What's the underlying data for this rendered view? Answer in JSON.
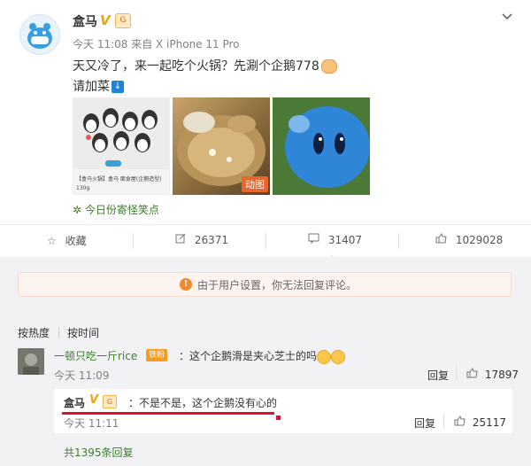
{
  "post": {
    "author": "盒马",
    "verified_mark": "V",
    "level_badge": "G",
    "meta": "今天 11:08 来自 X iPhone 11 Pro",
    "text_line1": "天又冷了，来一起吃个火锅？先涮个企鹅778",
    "text_line2": "请加菜",
    "download_icon": "↓",
    "images": [
      {
        "kind": "product-card",
        "caption": "【盒马火锅】盒马 面食屋(企鹅造型)",
        "weight": "130g"
      },
      {
        "kind": "hotpot",
        "badge": "动图"
      },
      {
        "kind": "blue-plush"
      }
    ],
    "topic": "今日份寄怪笑点",
    "menu_icon": "chevron-down-icon"
  },
  "actions": {
    "favorite_label": "收藏",
    "repost_count": "26371",
    "comment_count": "31407",
    "like_count": "1029028"
  },
  "notice": {
    "icon": "!",
    "text": "由于用户设置，你无法回复评论。"
  },
  "sort": {
    "hot": "按热度",
    "time": "按时间"
  },
  "comment": {
    "username": "一顿只吃一斤rice",
    "fan_badge": "铁粉",
    "text": "：这个企鹅滑是夹心芝士的吗",
    "time": "今天 11:09",
    "reply_label": "回复",
    "like_count": "17897",
    "subreply": {
      "username": "盒马",
      "verified_mark": "V",
      "level_badge": "G",
      "text": "：不是不是，这个企鹅没有心的",
      "time": "今天 11:11",
      "reply_label": "回复",
      "like_count": "25117"
    },
    "more_replies": "共1395条回复"
  },
  "colors": {
    "link_green": "#3d7d2c",
    "verified_orange": "#f0a30a",
    "annotation_red": "#e3102a",
    "notice_bg": "#fdf3ef"
  }
}
